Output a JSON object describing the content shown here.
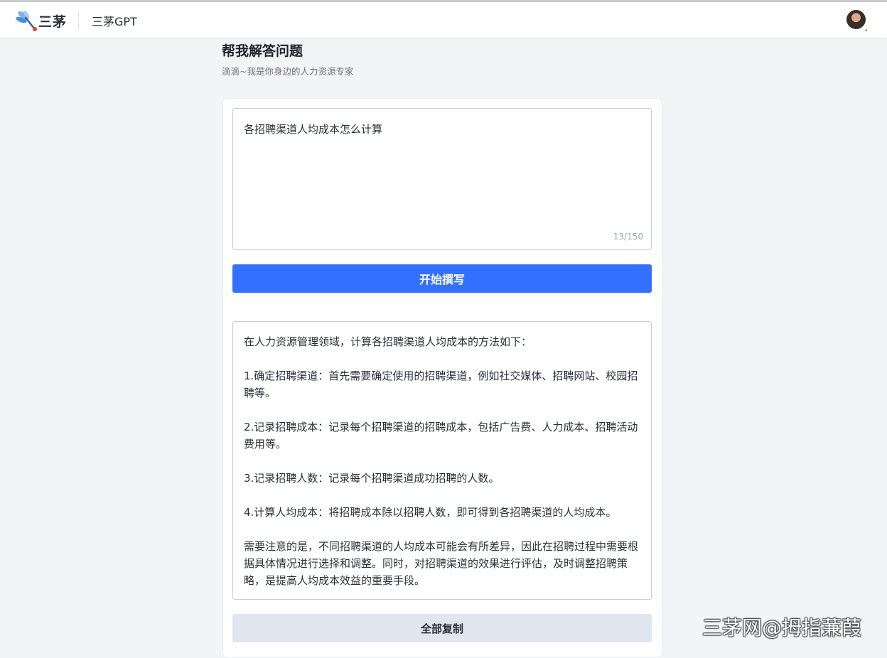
{
  "header": {
    "logo_text": "三茅",
    "app_name": "三茅GPT"
  },
  "page": {
    "title": "帮我解答问题",
    "subtitle": "滴滴~我是你身边的人力资源专家"
  },
  "question": {
    "value": "各招聘渠道人均成本怎么计算",
    "char_count": "13/150"
  },
  "buttons": {
    "start_label": "开始撰写",
    "copy_label": "全部复制"
  },
  "answer": {
    "paragraphs": [
      "在人力资源管理领域，计算各招聘渠道人均成本的方法如下：",
      "1.确定招聘渠道：首先需要确定使用的招聘渠道，例如社交媒体、招聘网站、校园招聘等。",
      "2.记录招聘成本：记录每个招聘渠道的招聘成本，包括广告费、人力成本、招聘活动费用等。",
      "3.记录招聘人数：记录每个招聘渠道成功招聘的人数。",
      "4.计算人均成本：将招聘成本除以招聘人数，即可得到各招聘渠道的人均成本。",
      "需要注意的是，不同招聘渠道的人均成本可能会有所差异，因此在招聘过程中需要根据具体情况进行选择和调整。同时，对招聘渠道的效果进行评估，及时调整招聘策略，是提高人均成本效益的重要手段。"
    ]
  },
  "watermark": "三茅网@拇指蒹葭",
  "colors": {
    "primary": "#3370ff",
    "copy_button_bg": "#e1e5f0",
    "page_bg": "#f3f4f6"
  }
}
